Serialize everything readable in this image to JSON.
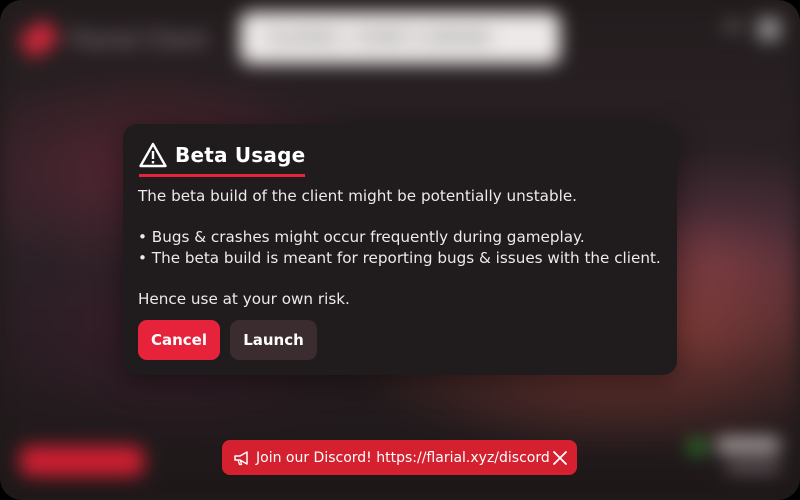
{
  "background": {
    "brand": "Flarial Client",
    "top_pill_text": "PLAYERS • START A SERVER"
  },
  "dialog": {
    "title": "Beta Usage",
    "line1": "The beta build of the client might be potentially unstable.",
    "bullet1": "• Bugs & crashes might occur frequently during gameplay.",
    "bullet2": "• The beta build is meant for reporting bugs & issues with the client.",
    "line_risk": "Hence use at your own risk.",
    "cancel_label": "Cancel",
    "launch_label": "Launch",
    "title_icon": "warning-icon"
  },
  "toast": {
    "text": "Join our Discord! https://flarial.xyz/discord",
    "icon": "megaphone-icon",
    "close_icon": "close-icon"
  },
  "colors": {
    "accent": "#e6233a",
    "toast": "#d5212f",
    "dialog_bg": "#201b1c",
    "secondary_button": "#3b2c2f"
  }
}
